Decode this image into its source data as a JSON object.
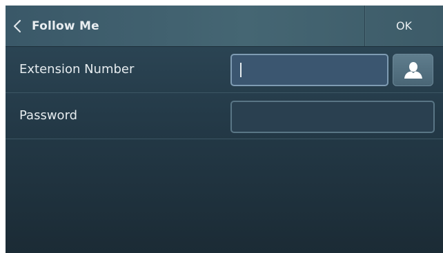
{
  "header": {
    "title": "Follow Me",
    "back_icon": "chevron-left-icon",
    "ok_label": "OK"
  },
  "form": {
    "extension": {
      "label": "Extension Number",
      "value": "",
      "contact_icon": "contact-person-icon"
    },
    "password": {
      "label": "Password",
      "value": ""
    }
  },
  "colors": {
    "background_top": "#2f4a5a",
    "background_bottom": "#1b2b35",
    "active_field": "#3b5670",
    "text": "#e6ecef"
  }
}
